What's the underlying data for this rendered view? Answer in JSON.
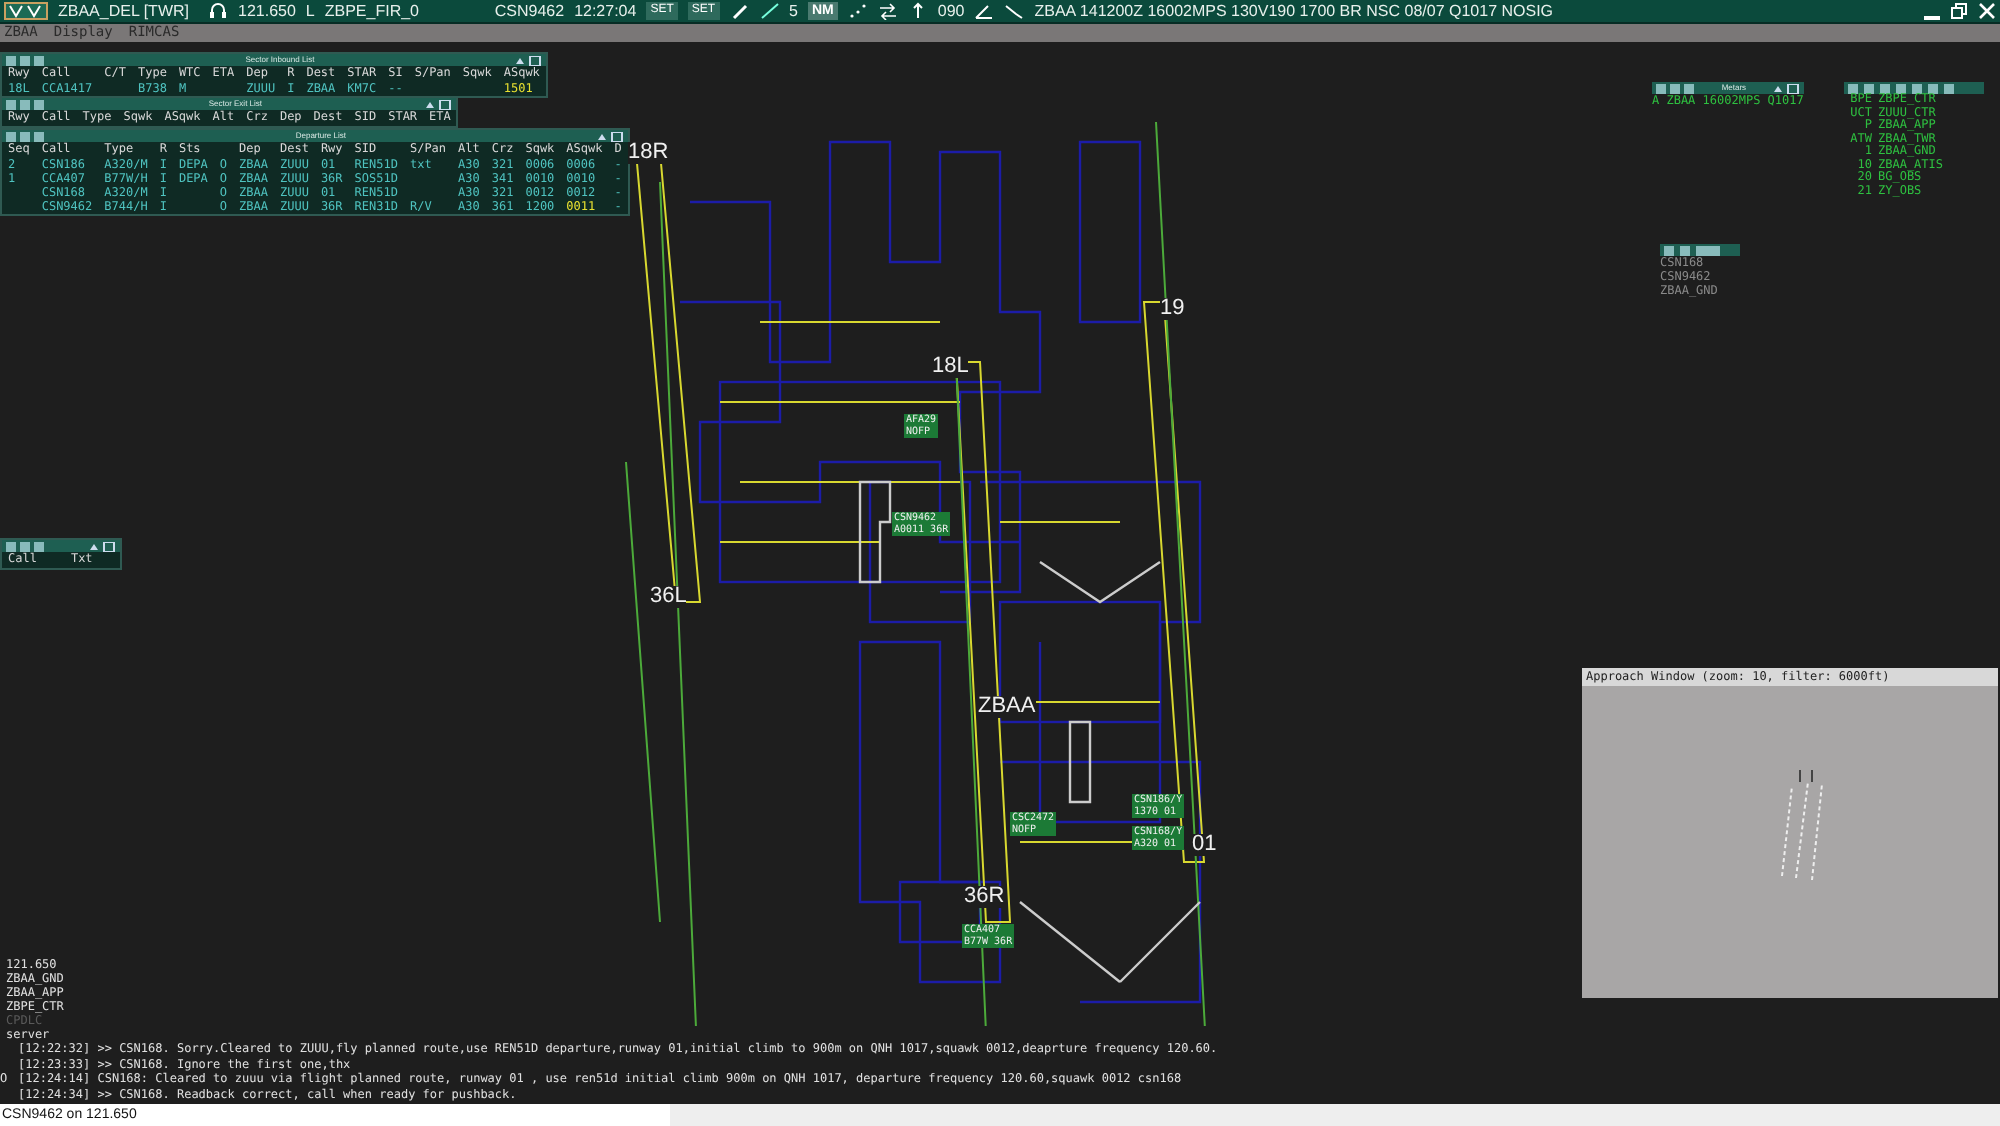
{
  "toolbar": {
    "position": "ZBAA_DEL [TWR]",
    "frequency": "121.650",
    "mode": "L",
    "fir": "ZBPE_FIR_0",
    "callsign": "CSN9462",
    "time": "12:27:04",
    "set_buttons": [
      "SET",
      "SET"
    ],
    "range": "5",
    "unit": "NM",
    "heading": "090",
    "metar": "ZBAA 141200Z 16002MPS 130V190 1700 BR NSC 08/07 Q1017 NOSIG"
  },
  "subheader": [
    "ZBAA",
    "Display",
    "RIMCAS"
  ],
  "inbound_list": {
    "title": "Sector Inbound List",
    "columns": [
      "Rwy",
      "Call",
      "C/T",
      "Type",
      "WTC",
      "ETA",
      "Dep",
      "R",
      "Dest",
      "STAR",
      "SI",
      "S/Pan",
      "Sqwk",
      "ASqwk"
    ],
    "rows": [
      {
        "cells": [
          "18L",
          "CCA1417",
          null,
          "B738",
          "M",
          null,
          "ZUUU",
          "I",
          "ZBAA",
          "KM7C",
          "--",
          null,
          null,
          "1501"
        ],
        "alert": true
      }
    ]
  },
  "exit_list": {
    "title": "Sector Exit List",
    "columns": [
      "Rwy",
      "Call",
      "Type",
      "Sqwk",
      "ASqwk",
      "Alt",
      "Crz",
      "Dep",
      "Dest",
      "SID",
      "STAR",
      "ETA"
    ]
  },
  "departure_list": {
    "title": "Departure List",
    "columns": [
      {
        "label": "Seq"
      },
      {
        "label": "Call"
      },
      {
        "label": "Type"
      },
      {
        "label": "R"
      },
      {
        "label": "Sts"
      },
      {},
      {
        "label": "Dep"
      },
      {
        "label": "Dest"
      },
      {
        "label": "Rwy"
      },
      {
        "label": "SID"
      },
      {
        "label": "S/Pan"
      },
      {
        "label": "Alt"
      },
      {
        "label": "Crz"
      },
      {
        "label": "Sqwk"
      },
      {
        "label": "ASqwk"
      },
      {
        "label": "D"
      }
    ],
    "rows": [
      {
        "cells": [
          "2",
          "CSN186",
          "A320/M",
          "I",
          "DEPA",
          "O",
          "ZBAA",
          "ZUUU",
          "01",
          "REN51D",
          "txt",
          "A30",
          "321",
          "0006",
          "0006",
          "-"
        ],
        "alert": false
      },
      {
        "cells": [
          "1",
          "CCA407",
          "B77W/H",
          "I",
          "DEPA",
          "O",
          "ZBAA",
          "ZUUU",
          "36R",
          "SOS51D",
          null,
          "A30",
          "341",
          "0010",
          "0010",
          "-"
        ],
        "alert": false
      },
      {
        "cells": [
          null,
          "CSN168",
          "A320/M",
          "I",
          null,
          "O",
          "ZBAA",
          "ZUUU",
          "01",
          "REN51D",
          null,
          "A30",
          "321",
          "0012",
          "0012",
          "-"
        ],
        "alert": false
      },
      {
        "cells": [
          null,
          "CSN9462",
          "B744/H",
          "I",
          null,
          "O",
          "ZBAA",
          "ZUUU",
          "36R",
          "REN31D",
          "R/V",
          "A30",
          "361",
          "1200",
          "0011",
          "-"
        ],
        "alert": true
      }
    ]
  },
  "atis_list": {
    "columns": [
      "Call",
      "Txt"
    ]
  },
  "metars": {
    "title": "Metars",
    "text": "A ZBAA 16002MPS Q1017"
  },
  "controllers": [
    {
      "code": "BPE",
      "name": "ZBPE_CTR"
    },
    {
      "code": "UCT",
      "name": "ZUUU_CTR"
    },
    {
      "code": "P",
      "name": "ZBAA_APP"
    },
    {
      "code": "ATW",
      "name": "ZBAA_TWR"
    },
    {
      "code": "1",
      "name": "ZBAA_GND"
    },
    {
      "code": "10",
      "name": "ZBAA_ATIS"
    },
    {
      "code": "20",
      "name": "BG_OBS"
    },
    {
      "code": "21",
      "name": "ZY_OBS"
    }
  ],
  "chat_tabs": [
    {
      "label": "CSN168",
      "selected": false
    },
    {
      "label": "CSN9462",
      "selected": false
    },
    {
      "label": "ZBAA_GND",
      "selected": false
    }
  ],
  "map": {
    "runways": [
      {
        "label": "18R"
      },
      {
        "label": "18L"
      },
      {
        "label": "19"
      },
      {
        "label": "36L"
      },
      {
        "label": "36R"
      },
      {
        "label": "01"
      }
    ],
    "airport_label": "ZBAA",
    "tags": [
      {
        "line1": "AFA29",
        "line2": "NOFP"
      },
      {
        "line1": "CSN9462",
        "line2": "A0011 36R"
      },
      {
        "line1": "CSC2472",
        "line2": "NOFP"
      },
      {
        "line1": "CSN186/Y",
        "line2": "1370 01"
      },
      {
        "line1": "CSN168/Y",
        "line2": "A320 01"
      },
      {
        "line1": "CCA407",
        "line2": "B77W 36R"
      }
    ]
  },
  "approach_window": {
    "title": "Approach Window (zoom: 10, filter: 6000ft)"
  },
  "channels": [
    {
      "label": "121.650",
      "disabled": false
    },
    {
      "label": "ZBAA_GND",
      "disabled": false
    },
    {
      "label": "ZBAA_APP",
      "disabled": false
    },
    {
      "label": "ZBPE_CTR",
      "disabled": false
    },
    {
      "label": "CPDLC",
      "disabled": true
    },
    {
      "label": "server",
      "disabled": false
    }
  ],
  "messages": [
    {
      "text": "[12:22:32] >> CSN168. Sorry.Cleared to ZUUU,fly planned route,use REN51D departure,runway 01,initial climb to 900m on QNH 1017,squawk 0012,deaprture frequency 120.60."
    },
    {
      "text": "[12:23:33] >> CSN168. Ignore the first one,thx"
    },
    {
      "prefix": "O",
      "text": "[12:24:14] CSN168: Cleared to zuuu via flight planned route, runway 01 , use ren51d  initial climb 900m on QNH 1017, departure frequency 120.60,squawk 0012 csn168"
    },
    {
      "text": "[12:24:34] >> CSN168. Readback correct, call when ready for pushback."
    }
  ],
  "input": {
    "value": "CSN9462 on 121.650"
  }
}
